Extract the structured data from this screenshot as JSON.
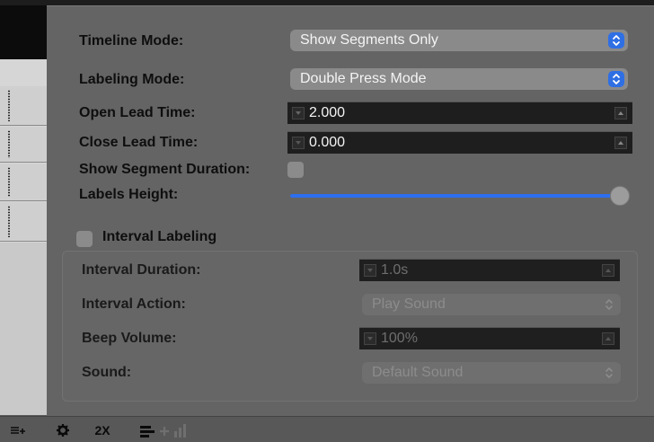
{
  "settings": {
    "timeline_mode": {
      "label": "Timeline Mode:",
      "value": "Show Segments Only"
    },
    "labeling_mode": {
      "label": "Labeling Mode:",
      "value": "Double Press Mode"
    },
    "open_lead_time": {
      "label": "Open Lead Time:",
      "value": "2.000"
    },
    "close_lead_time": {
      "label": "Close Lead Time:",
      "value": "0.000"
    },
    "show_segment_duration": {
      "label": "Show Segment Duration:",
      "checked": false
    },
    "labels_height": {
      "label": "Labels Height:",
      "level": 1.0
    }
  },
  "interval": {
    "toggle_label": "Interval Labeling",
    "enabled": false,
    "duration": {
      "label": "Interval Duration:",
      "value": "1.0s"
    },
    "action": {
      "label": "Interval Action:",
      "value": "Play Sound"
    },
    "beep_volume": {
      "label": "Beep Volume:",
      "value": "100%"
    },
    "sound": {
      "label": "Sound:",
      "value": "Default Sound"
    }
  },
  "toolbar": {
    "speed_label": "2X",
    "icons": [
      "add-list-icon",
      "gear-icon",
      "speed-icon",
      "add-track-icon"
    ]
  },
  "colors": {
    "accent": "#2f6fe4",
    "panel": "#646464"
  }
}
